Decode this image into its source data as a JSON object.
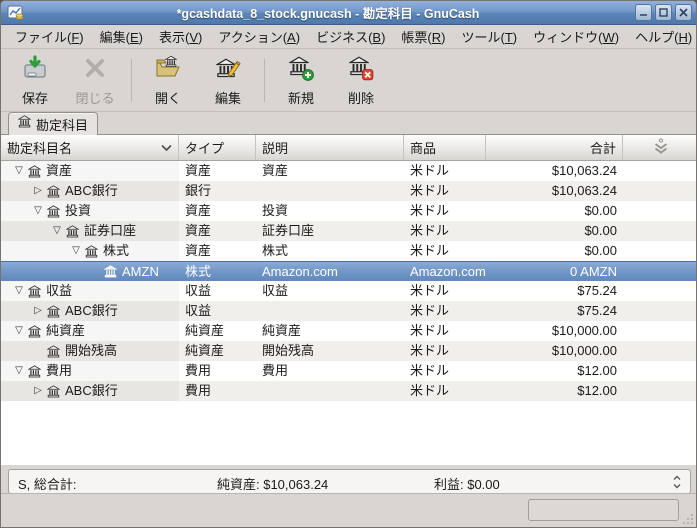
{
  "window": {
    "title": "*gcashdata_8_stock.gnucash - 勘定科目 - GnuCash",
    "controls": [
      {
        "name": "minimize-button",
        "icon": "minimize-icon"
      },
      {
        "name": "maximize-button",
        "icon": "maximize-icon"
      },
      {
        "name": "close-button",
        "icon": "close-icon"
      }
    ]
  },
  "menu": {
    "items": [
      {
        "label": "ファイル(F)"
      },
      {
        "label": "編集(E)"
      },
      {
        "label": "表示(V)"
      },
      {
        "label": "アクション(A)"
      },
      {
        "label": "ビジネス(B)"
      },
      {
        "label": "帳票(R)"
      },
      {
        "label": "ツール(T)"
      },
      {
        "label": "ウィンドウ(W)"
      },
      {
        "label": "ヘルプ(H)"
      }
    ]
  },
  "toolbar": {
    "buttons": [
      {
        "label": "保存",
        "icon": "save-icon",
        "enabled": true,
        "group": 1
      },
      {
        "label": "閉じる",
        "icon": "close-tab-icon",
        "enabled": false,
        "group": 1
      },
      {
        "label": "開く",
        "icon": "open-account-icon",
        "enabled": true,
        "group": 2
      },
      {
        "label": "編集",
        "icon": "edit-account-icon",
        "enabled": true,
        "group": 2
      },
      {
        "label": "新規",
        "icon": "new-account-icon",
        "enabled": true,
        "group": 3
      },
      {
        "label": "削除",
        "icon": "delete-account-icon",
        "enabled": true,
        "group": 3
      }
    ]
  },
  "tab": {
    "label": "勘定科目",
    "icon": "bank-icon"
  },
  "table": {
    "headers": {
      "name": "勘定科目名",
      "type": "タイプ",
      "description": "説明",
      "commodity": "商品",
      "total": "合計"
    },
    "sort_column": "name",
    "rows": [
      {
        "name": "資産",
        "type": "資産",
        "description": "資産",
        "commodity": "米ドル",
        "total": "$10,063.24",
        "level": 0,
        "expander": "expanded",
        "selected": false
      },
      {
        "name": "ABC銀行",
        "type": "銀行",
        "description": "",
        "commodity": "米ドル",
        "total": "$10,063.24",
        "level": 1,
        "expander": "collapsed",
        "selected": false
      },
      {
        "name": "投資",
        "type": "資産",
        "description": "投資",
        "commodity": "米ドル",
        "total": "$0.00",
        "level": 1,
        "expander": "expanded",
        "selected": false
      },
      {
        "name": "証券口座",
        "type": "資産",
        "description": "証券口座",
        "commodity": "米ドル",
        "total": "$0.00",
        "level": 2,
        "expander": "expanded",
        "selected": false
      },
      {
        "name": "株式",
        "type": "資産",
        "description": "株式",
        "commodity": "米ドル",
        "total": "$0.00",
        "level": 3,
        "expander": "expanded",
        "selected": false
      },
      {
        "name": "AMZN",
        "type": "株式",
        "description": "Amazon.com",
        "commodity": "Amazon.com",
        "total": "0 AMZN",
        "level": 4,
        "expander": "none",
        "selected": true
      },
      {
        "name": "収益",
        "type": "収益",
        "description": "収益",
        "commodity": "米ドル",
        "total": "$75.24",
        "level": 0,
        "expander": "expanded",
        "selected": false
      },
      {
        "name": "ABC銀行",
        "type": "収益",
        "description": "",
        "commodity": "米ドル",
        "total": "$75.24",
        "level": 1,
        "expander": "collapsed",
        "selected": false
      },
      {
        "name": "純資産",
        "type": "純資産",
        "description": "純資産",
        "commodity": "米ドル",
        "total": "$10,000.00",
        "level": 0,
        "expander": "expanded",
        "selected": false
      },
      {
        "name": "開始残高",
        "type": "純資産",
        "description": "開始残高",
        "commodity": "米ドル",
        "total": "$10,000.00",
        "level": 1,
        "expander": "none",
        "selected": false
      },
      {
        "name": "費用",
        "type": "費用",
        "description": "費用",
        "commodity": "米ドル",
        "total": "$12.00",
        "level": 0,
        "expander": "expanded",
        "selected": false
      },
      {
        "name": "ABC銀行",
        "type": "費用",
        "description": "",
        "commodity": "米ドル",
        "total": "$12.00",
        "level": 1,
        "expander": "collapsed",
        "selected": false
      }
    ]
  },
  "summary_bar": {
    "prefix": "S, 総合計:",
    "net_assets": "純資産: $10,063.24",
    "profit": "利益: $0.00"
  },
  "colors": {
    "titlebar_blue": "#6b90c0",
    "selection_blue": "#7398c8",
    "chrome_gray": "#d9d5d2",
    "alt_row": "#f1efec",
    "new_badge_green": "#2e9e3c",
    "delete_badge_red": "#d43c2a",
    "save_arrow_green": "#3a9440"
  }
}
